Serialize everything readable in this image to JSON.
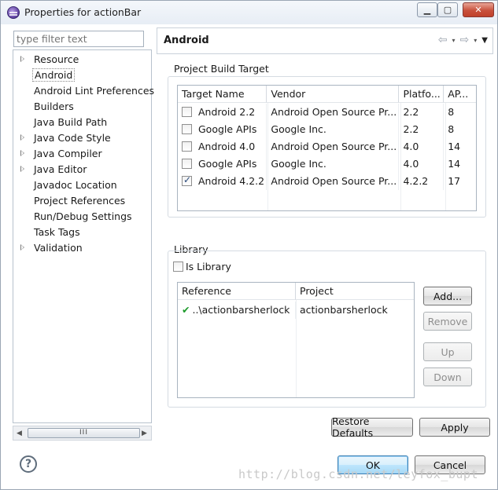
{
  "window": {
    "title": "Properties for actionBar",
    "controls": {
      "minimize": "▁",
      "maximize": "▢",
      "close": "✕"
    }
  },
  "sidebar": {
    "filter_placeholder": "type filter text",
    "items": [
      {
        "label": "Resource",
        "expandable": true
      },
      {
        "label": "Android",
        "expandable": false,
        "selected": true
      },
      {
        "label": "Android Lint Preferences",
        "expandable": false
      },
      {
        "label": "Builders",
        "expandable": false
      },
      {
        "label": "Java Build Path",
        "expandable": false
      },
      {
        "label": "Java Code Style",
        "expandable": true
      },
      {
        "label": "Java Compiler",
        "expandable": true
      },
      {
        "label": "Java Editor",
        "expandable": true
      },
      {
        "label": "Javadoc Location",
        "expandable": false
      },
      {
        "label": "Project References",
        "expandable": false
      },
      {
        "label": "Run/Debug Settings",
        "expandable": false
      },
      {
        "label": "Task Tags",
        "expandable": false
      },
      {
        "label": "Validation",
        "expandable": true
      }
    ],
    "scrollbar": {
      "left_arrow": "◀",
      "right_arrow": "▶",
      "thumb_grip": "III"
    }
  },
  "page": {
    "title": "Android",
    "nav": {
      "back": "⇦",
      "forward": "⇨",
      "dropdown": "▾",
      "menu": "▼"
    }
  },
  "build_target": {
    "group_label": "Project Build Target",
    "columns": [
      "Target Name",
      "Vendor",
      "Platfo...",
      "AP..."
    ],
    "rows": [
      {
        "checked": false,
        "name": "Android 2.2",
        "vendor": "Android Open Source Pr...",
        "platform": "2.2",
        "api": "8"
      },
      {
        "checked": false,
        "name": "Google APIs",
        "vendor": "Google Inc.",
        "platform": "2.2",
        "api": "8"
      },
      {
        "checked": false,
        "name": "Android 4.0",
        "vendor": "Android Open Source Pr...",
        "platform": "4.0",
        "api": "14"
      },
      {
        "checked": false,
        "name": "Google APIs",
        "vendor": "Google Inc.",
        "platform": "4.0",
        "api": "14"
      },
      {
        "checked": true,
        "name": "Android 4.2.2",
        "vendor": "Android Open Source Pr...",
        "platform": "4.2.2",
        "api": "17"
      }
    ]
  },
  "library": {
    "group_label": "Library",
    "is_library_label": "Is Library",
    "is_library_checked": false,
    "columns": [
      "Reference",
      "Project"
    ],
    "rows": [
      {
        "status_icon": "✔",
        "reference": "..\\actionbarsherlock",
        "project": "actionbarsherlock"
      }
    ],
    "buttons": {
      "add": "Add...",
      "remove": "Remove",
      "up": "Up",
      "down": "Down"
    }
  },
  "actions": {
    "restore_defaults": "Restore Defaults",
    "apply": "Apply",
    "ok": "OK",
    "cancel": "Cancel",
    "help_icon": "?"
  },
  "watermark": "http://blog.csdn.net/leyfox_bupt"
}
